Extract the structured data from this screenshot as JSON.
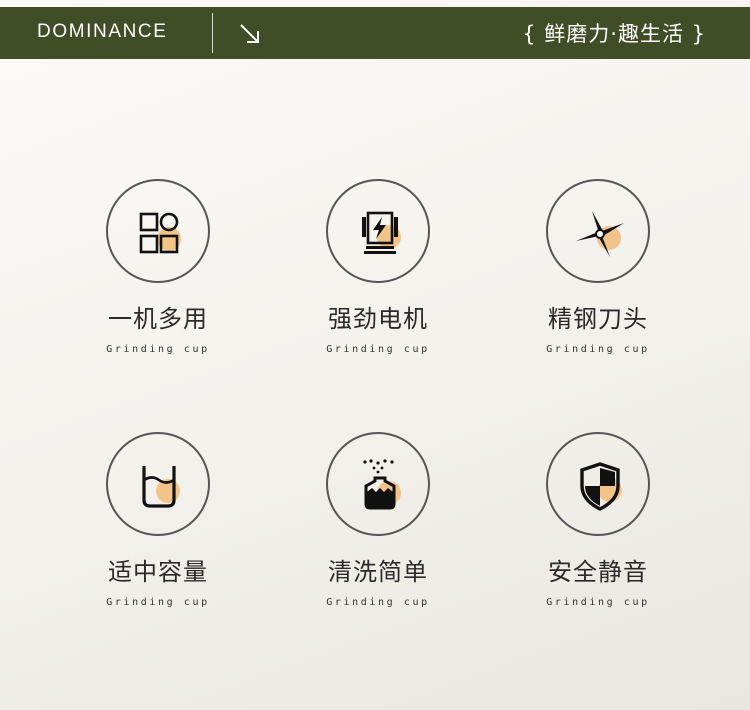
{
  "header": {
    "brand": "DOMINANCE",
    "slogan": "{ 鲜磨力·趣生活 }",
    "bg_color": "#414d26"
  },
  "accent_color": "#f2c48a",
  "features": [
    {
      "title": "一机多用",
      "subtitle": "Grinding cup",
      "icon": "multi-use-grid-icon"
    },
    {
      "title": "强劲电机",
      "subtitle": "Grinding cup",
      "icon": "motor-lightning-icon"
    },
    {
      "title": "精钢刀头",
      "subtitle": "Grinding cup",
      "icon": "blade-icon"
    },
    {
      "title": "适中容量",
      "subtitle": "Grinding cup",
      "icon": "cup-capacity-icon"
    },
    {
      "title": "清洗简单",
      "subtitle": "Grinding cup",
      "icon": "easy-clean-icon"
    },
    {
      "title": "安全静音",
      "subtitle": "Grinding cup",
      "icon": "safety-shield-icon"
    }
  ]
}
